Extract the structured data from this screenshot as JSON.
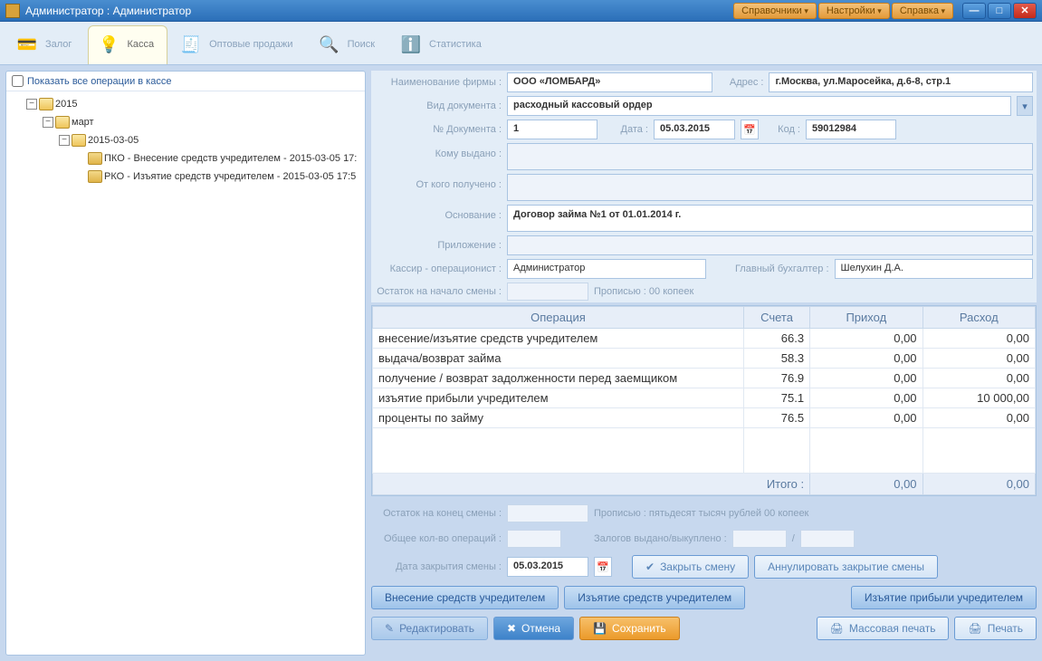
{
  "title": "Администратор : Администратор",
  "topmenu": {
    "dictionaries": "Справочники",
    "settings": "Настройки",
    "help": "Справка"
  },
  "tabs": {
    "pledge": "Залог",
    "cash": "Касса",
    "wholesale": "Оптовые продажи",
    "search": "Поиск",
    "stats": "Статистика"
  },
  "left": {
    "show_all": "Показать все операции в кассе",
    "year": "2015",
    "month": "март",
    "day": "2015-03-05",
    "ops": [
      "ПКО - Внесение средств учредителем - 2015-03-05 17:",
      "РКО - Изъятие средств учредителем - 2015-03-05 17:5"
    ]
  },
  "form": {
    "company_lbl": "Наименование фирмы :",
    "company": "ООО «ЛОМБАРД»",
    "address_lbl": "Адрес :",
    "address": "г.Москва, ул.Маросейка, д.6-8, стр.1",
    "doctype_lbl": "Вид документа :",
    "doctype": "расходный кассовый ордер",
    "docnum_lbl": "№ Документа :",
    "docnum": "1",
    "date_lbl": "Дата :",
    "date": "05.03.2015",
    "code_lbl": "Код :",
    "code": "59012984",
    "issued_lbl": "Кому выдано :",
    "from_lbl": "От кого получено :",
    "basis_lbl": "Основание :",
    "basis": "Договор займа №1 от 01.01.2014 г.",
    "attach_lbl": "Приложение :",
    "cashier_lbl": "Кассир - операционист :",
    "cashier": "Администратор",
    "accountant_lbl": "Главный бухгалтер :",
    "accountant": "Шелухин Д.А.",
    "startbal_lbl": "Остаток на начало смены :",
    "inwords_lbl": "Прописью :",
    "inwords_start": "00 копеек"
  },
  "table": {
    "headers": {
      "op": "Операция",
      "acc": "Счета",
      "in": "Приход",
      "out": "Расход"
    },
    "rows": [
      {
        "op": "внесение/изъятие средств учредителем",
        "acc": "66.3",
        "in": "0,00",
        "out": "0,00"
      },
      {
        "op": "выдача/возврат займа",
        "acc": "58.3",
        "in": "0,00",
        "out": "0,00"
      },
      {
        "op": "получение / возврат задолженности перед заемщиком",
        "acc": "76.9",
        "in": "0,00",
        "out": "0,00"
      },
      {
        "op": "изъятие прибыли учредителем",
        "acc": "75.1",
        "in": "0,00",
        "out": "10 000,00"
      },
      {
        "op": "проценты по займу",
        "acc": "76.5",
        "in": "0,00",
        "out": "0,00"
      }
    ],
    "total_lbl": "Итого :",
    "total_in": "0,00",
    "total_out": "0,00"
  },
  "bottom": {
    "endbal_lbl": "Остаток на конец смены :",
    "inwords2": "пятьдесят тысяч рублей 00 копеек",
    "total_ops_lbl": "Общее кол-во операций :",
    "pledges_lbl": "Залогов выдано/выкуплено :",
    "closedate_lbl": "Дата закрытия смены :",
    "closedate": "05.03.2015",
    "close_btn": "Закрыть смену",
    "cancel_close_btn": "Аннулировать закрытие смены",
    "deposit_btn": "Внесение средств учредителем",
    "withdraw_btn": "Изъятие средств учредителем",
    "profit_btn": "Изъятие прибыли учредителем",
    "edit_btn": "Редактировать",
    "cancel_btn": "Отмена",
    "save_btn": "Сохранить",
    "massprint_btn": "Массовая печать",
    "print_btn": "Печать"
  }
}
